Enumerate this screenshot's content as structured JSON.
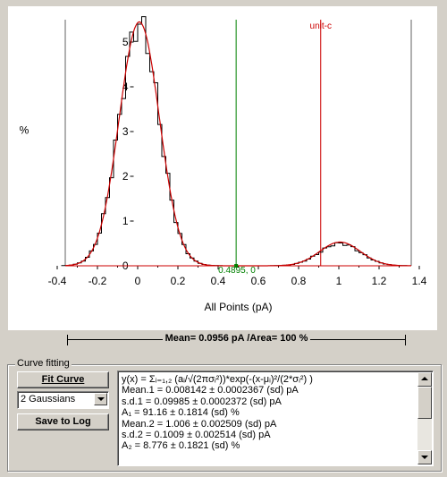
{
  "chart_data": {
    "type": "line",
    "title": "",
    "xlabel": "All Points (pA)",
    "ylabel": "%",
    "xlim": [
      -0.4,
      1.4
    ],
    "ylim": [
      0,
      5.5
    ],
    "x_ticks": [
      "-0.4",
      "-0.2",
      "0",
      "0.2",
      "0.4",
      "0.6",
      "0.8",
      "1",
      "1.2",
      "1.4"
    ],
    "y_ticks": [
      "0",
      "1",
      "2",
      "3",
      "4",
      "5"
    ],
    "series": [
      {
        "kind": "histogram",
        "color": "#000000",
        "mean": 0.008142,
        "sd": 0.09985,
        "peak": 5.4,
        "mean2": 1.006,
        "sd2": 0.1009,
        "peak2": 0.5
      },
      {
        "kind": "fit",
        "color": "#cc0000",
        "components": [
          {
            "mean": 0.008142,
            "sd": 0.09985,
            "peak": 5.45
          },
          {
            "mean": 1.006,
            "sd": 0.1009,
            "peak": 0.53
          }
        ]
      }
    ],
    "markers": [
      {
        "x": -0.36,
        "color": "#606060",
        "label": ""
      },
      {
        "x": 0.4895,
        "color": "#008000",
        "label": "0.4895, 0"
      },
      {
        "x": 0.91,
        "color": "#cc0000",
        "label": "unit-c"
      },
      {
        "x": 1.36,
        "color": "#606060",
        "label": ""
      }
    ],
    "baseline_color": "#cc0000"
  },
  "summary": {
    "mean_text": "Mean= 0.0956 pA /Area= 100 %"
  },
  "curve_fitting": {
    "legend": "Curve fitting",
    "fit_button": "Fit Curve",
    "model_selected": "2 Gaussians",
    "save_button": "Save to Log",
    "results": [
      "y(x) = Σᵢ₌₁,₂ (aᵢ/√(2πσᵢ²))*exp(-(x-μᵢ)²/(2*σᵢ²) )",
      "Mean.1 = 0.008142 ± 0.0002367 (sd) pA",
      "s.d.1 = 0.09985 ± 0.0002372 (sd) pA",
      "A₁ = 91.16 ± 0.1814 (sd) %",
      "Mean.2 = 1.006 ± 0.002509 (sd) pA",
      "s.d.2 = 0.1009 ± 0.002514 (sd) pA",
      "A₂ = 8.776 ± 0.1821 (sd) %"
    ]
  }
}
